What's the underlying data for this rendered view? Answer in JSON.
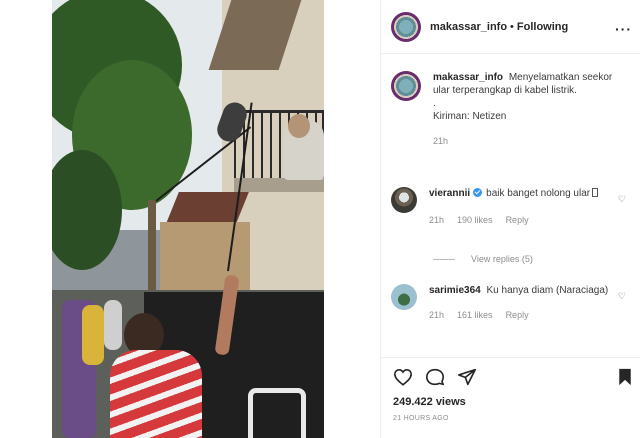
{
  "post": {
    "username": "makassar_info",
    "follow_separator": "•",
    "follow_status": "Following",
    "more_label": "···"
  },
  "caption": {
    "username": "makassar_info",
    "text": "Menyelamatkan seekor ular terperangkap di kabel listrik.",
    "dot": ".",
    "credit": "Kiriman: Netizen",
    "time": "21h"
  },
  "comments": [
    {
      "username": "vierannii",
      "text": "baik banget nolong ular",
      "time": "21h",
      "likes": "190 likes",
      "reply_label": "Reply"
    },
    {
      "username": "sarimie364",
      "text": "Ku hanya diam (Naraciaga)",
      "time": "21h",
      "likes": "161 likes",
      "reply_label": "Reply"
    }
  ],
  "view_replies": "View replies (5)",
  "stats": {
    "views": "249.422 views",
    "ago": "21 HOURS AGO"
  },
  "icons": {
    "more": "more-options-icon",
    "like": "heart-icon",
    "comment": "comment-icon",
    "share": "share-icon",
    "save": "bookmark-icon"
  }
}
